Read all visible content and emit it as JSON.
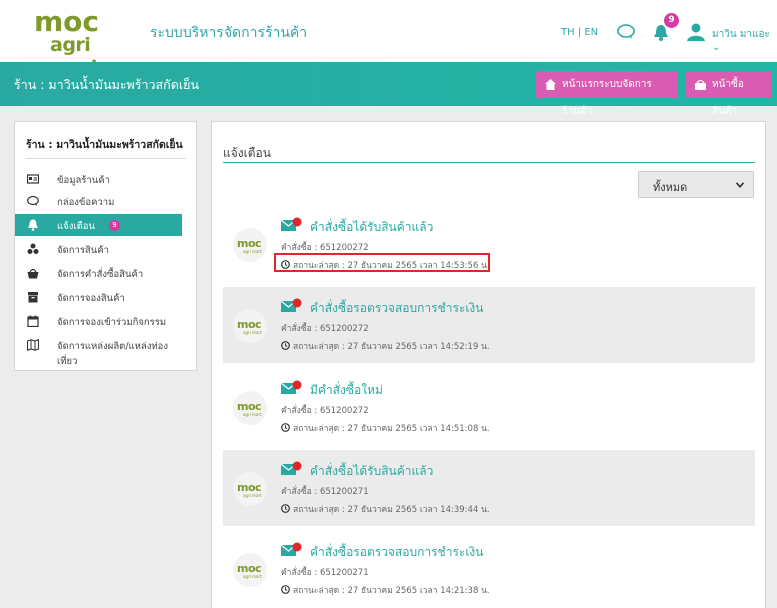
{
  "header": {
    "logo_text": "agri mart",
    "logo_brand": "moc",
    "system_title": "ระบบบริหารจัดการร้านค้า",
    "language": "TH | EN",
    "notification_count": "9",
    "user_name": "มาวิน มาแอะ"
  },
  "shopbar": {
    "shop_title": "ร้าน : มาวินน้ำมันมะพร้าวสกัดเย็น",
    "home_button": "หน้าแรกระบบจัดการร้านค้า",
    "shop_button": "หน้าซื้อสินค้า"
  },
  "sidebar": {
    "title": "ร้าน : มาวินน้ำมันมะพร้าวสกัดเย็น",
    "items": [
      {
        "label": "ข้อมูลร้านค้า",
        "icon": "id-card-icon"
      },
      {
        "label": "กล่องข้อความ",
        "icon": "chat-icon"
      },
      {
        "label": "แจ้งเตือน",
        "icon": "bell-icon",
        "badge": "9"
      },
      {
        "label": "จัดการสินค้า",
        "icon": "boxes-icon"
      },
      {
        "label": "จัดการคำสั่งซื้อสินค้า",
        "icon": "basket-icon"
      },
      {
        "label": "จัดการจองสินค้า",
        "icon": "archive-icon"
      },
      {
        "label": "จัดการจองเข้าร่วมกิจกรรม",
        "icon": "calendar-icon"
      },
      {
        "label": "จัดการแหล่งผลิต/แหล่งท่องเที่ยว",
        "icon": "map-icon"
      }
    ]
  },
  "main": {
    "title": "แจ้งเตือน",
    "filter_value": "ทั้งหมด",
    "notifications": [
      {
        "title": "คำสั่งซื้อได้รับสินค้าแล้ว",
        "order": "คำสั่งซื้อ : 651200272",
        "status": "สถานะล่าสุด : 27 ธันวาคม 2565 เวลา 14:53:56 น."
      },
      {
        "title": "คำสั่งซื้อรอตรวจสอบการชำระเงิน",
        "order": "คำสั่งซื้อ : 651200272",
        "status": "สถานะล่าสุด : 27 ธันวาคม 2565 เวลา 14:52:19 น."
      },
      {
        "title": "มีคำสั่งซื้อใหม่",
        "order": "คำสั่งซื้อ : 651200272",
        "status": "สถานะล่าสุด : 27 ธันวาคม 2565 เวลา 14:51:08 น."
      },
      {
        "title": "คำสั่งซื้อได้รับสินค้าแล้ว",
        "order": "คำสั่งซื้อ : 651200271",
        "status": "สถานะล่าสุด : 27 ธันวาคม 2565 เวลา 14:39:44 น."
      },
      {
        "title": "คำสั่งซื้อรอตรวจสอบการชำระเงิน",
        "order": "คำสั่งซื้อ : 651200271",
        "status": "สถานะล่าสุด : 27 ธันวาคม 2565 เวลา 14:21:38 น."
      }
    ]
  },
  "colors": {
    "accent": "#2aa9a2",
    "pink": "#d95bb2",
    "highlight": "#e0262a"
  }
}
